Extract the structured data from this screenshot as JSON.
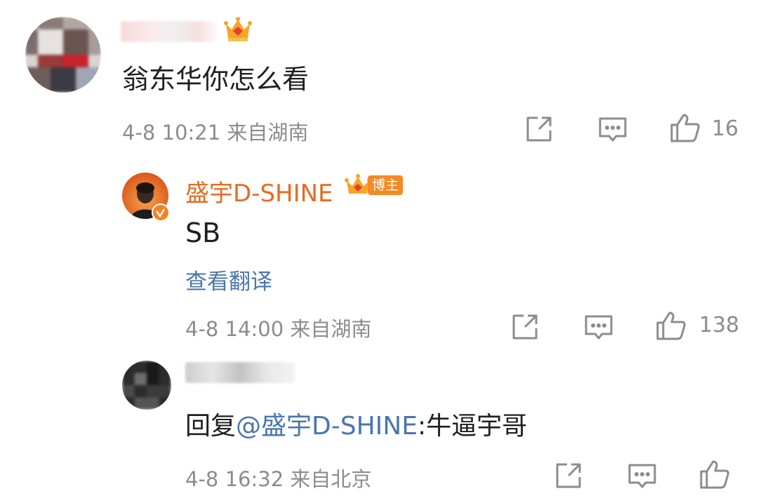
{
  "comment1": {
    "text": "翁东华你怎么看",
    "meta": "4-8 10:21 来自湖南",
    "like_count": "16"
  },
  "reply1": {
    "author": "盛宇D-SHINE",
    "badge": "博主",
    "text": "SB",
    "translate_label": "查看翻译",
    "meta": "4-8 14:00 来自湖南",
    "like_count": "138"
  },
  "reply2": {
    "reply_prefix": "回复",
    "mention": "@盛宇D-SHINE",
    "reply_text": ":牛逼宇哥",
    "meta": "4-8 16:32 来自北京"
  },
  "colors": {
    "author_orange": "#e86b1f",
    "link_blue": "#4a76ad",
    "meta_gray": "#8c8c8c"
  },
  "icons": [
    "crown-badge-icon",
    "share-icon",
    "comment-icon",
    "like-icon",
    "verified-icon"
  ]
}
